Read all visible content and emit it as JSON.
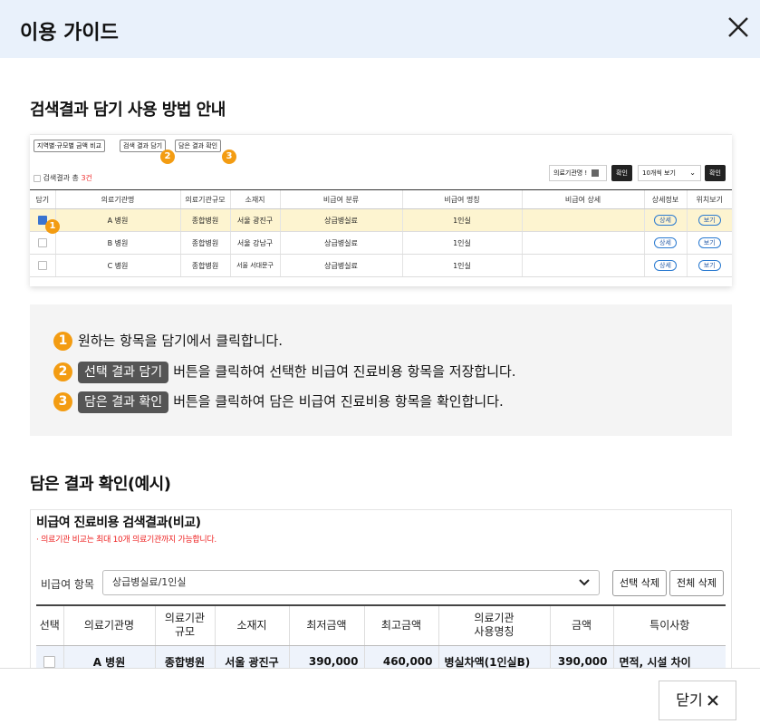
{
  "dialog": {
    "title": "이용 가이드"
  },
  "section1": {
    "title": "검색결과 담기 사용 방법 안내"
  },
  "shot1": {
    "buttons": [
      "지역별·규모별 금액 비교",
      "검색 결과 담기",
      "담은 결과 확인"
    ],
    "count_prefix": "검색결과 총 ",
    "count_value": "3건",
    "filter_label": "의료기관명 !",
    "confirm_label": "확인",
    "page_size": "10개씩 보기",
    "columns": [
      "담기",
      "의료기관명",
      "의료기관규모",
      "소재지",
      "비급여 분류",
      "비급여 명칭",
      "비급여 상세",
      "상세정보",
      "위치보기"
    ],
    "rows": [
      {
        "name": "A 병원",
        "size": "종합병원",
        "addr": "서울 광진구",
        "cat": "상급병실료",
        "item": "1인실",
        "detail": "",
        "info": "상세",
        "map": "보기"
      },
      {
        "name": "B 병원",
        "size": "종합병원",
        "addr": "서울 강남구",
        "cat": "상급병실료",
        "item": "1인실",
        "detail": "",
        "info": "상세",
        "map": "보기"
      },
      {
        "name": "C 병원",
        "size": "종합병원",
        "addr": "서울 서대문구",
        "cat": "상급병실료",
        "item": "1인실",
        "detail": "",
        "info": "상세",
        "map": "보기"
      }
    ],
    "badges": [
      "1",
      "2",
      "3"
    ]
  },
  "guide": {
    "steps": [
      {
        "num": "1",
        "chip": "",
        "text": "원하는 항목을 담기에서 클릭합니다."
      },
      {
        "num": "2",
        "chip": "선택 결과 담기",
        "text": "버튼을 클릭하여 선택한 비급여 진료비용 항목을 저장합니다."
      },
      {
        "num": "3",
        "chip": "담은 결과 확인",
        "text": "버튼을 클릭하여 담은 비급여 진료비용 항목을 확인합니다."
      }
    ]
  },
  "section2": {
    "title": "담은 결과 확인(예시)"
  },
  "shot2": {
    "title": "비급여 진료비용 검색결과(비교)",
    "note": "· 의료기관 비교는 최대 10개 의료기관까지 가능합니다.",
    "filter_label": "비급여 항목",
    "filter_value": "상급병실료/1인실",
    "delete_selected": "선택 삭제",
    "delete_all": "전체 삭제",
    "columns": [
      "선택",
      "의료기관명",
      "의료기관\n규모",
      "소재지",
      "최저금액",
      "최고금액",
      "의료기관\n사용명칭",
      "금액",
      "특이사항"
    ],
    "row": {
      "name": "A 병원",
      "size": "종합병원",
      "addr": "서울 광진구",
      "min": "390,000",
      "max": "460,000",
      "usage": "병실차액(1인실B)",
      "price": "390,000",
      "note": "면적, 시설 차이"
    }
  },
  "footer": {
    "close_label": "닫기"
  }
}
